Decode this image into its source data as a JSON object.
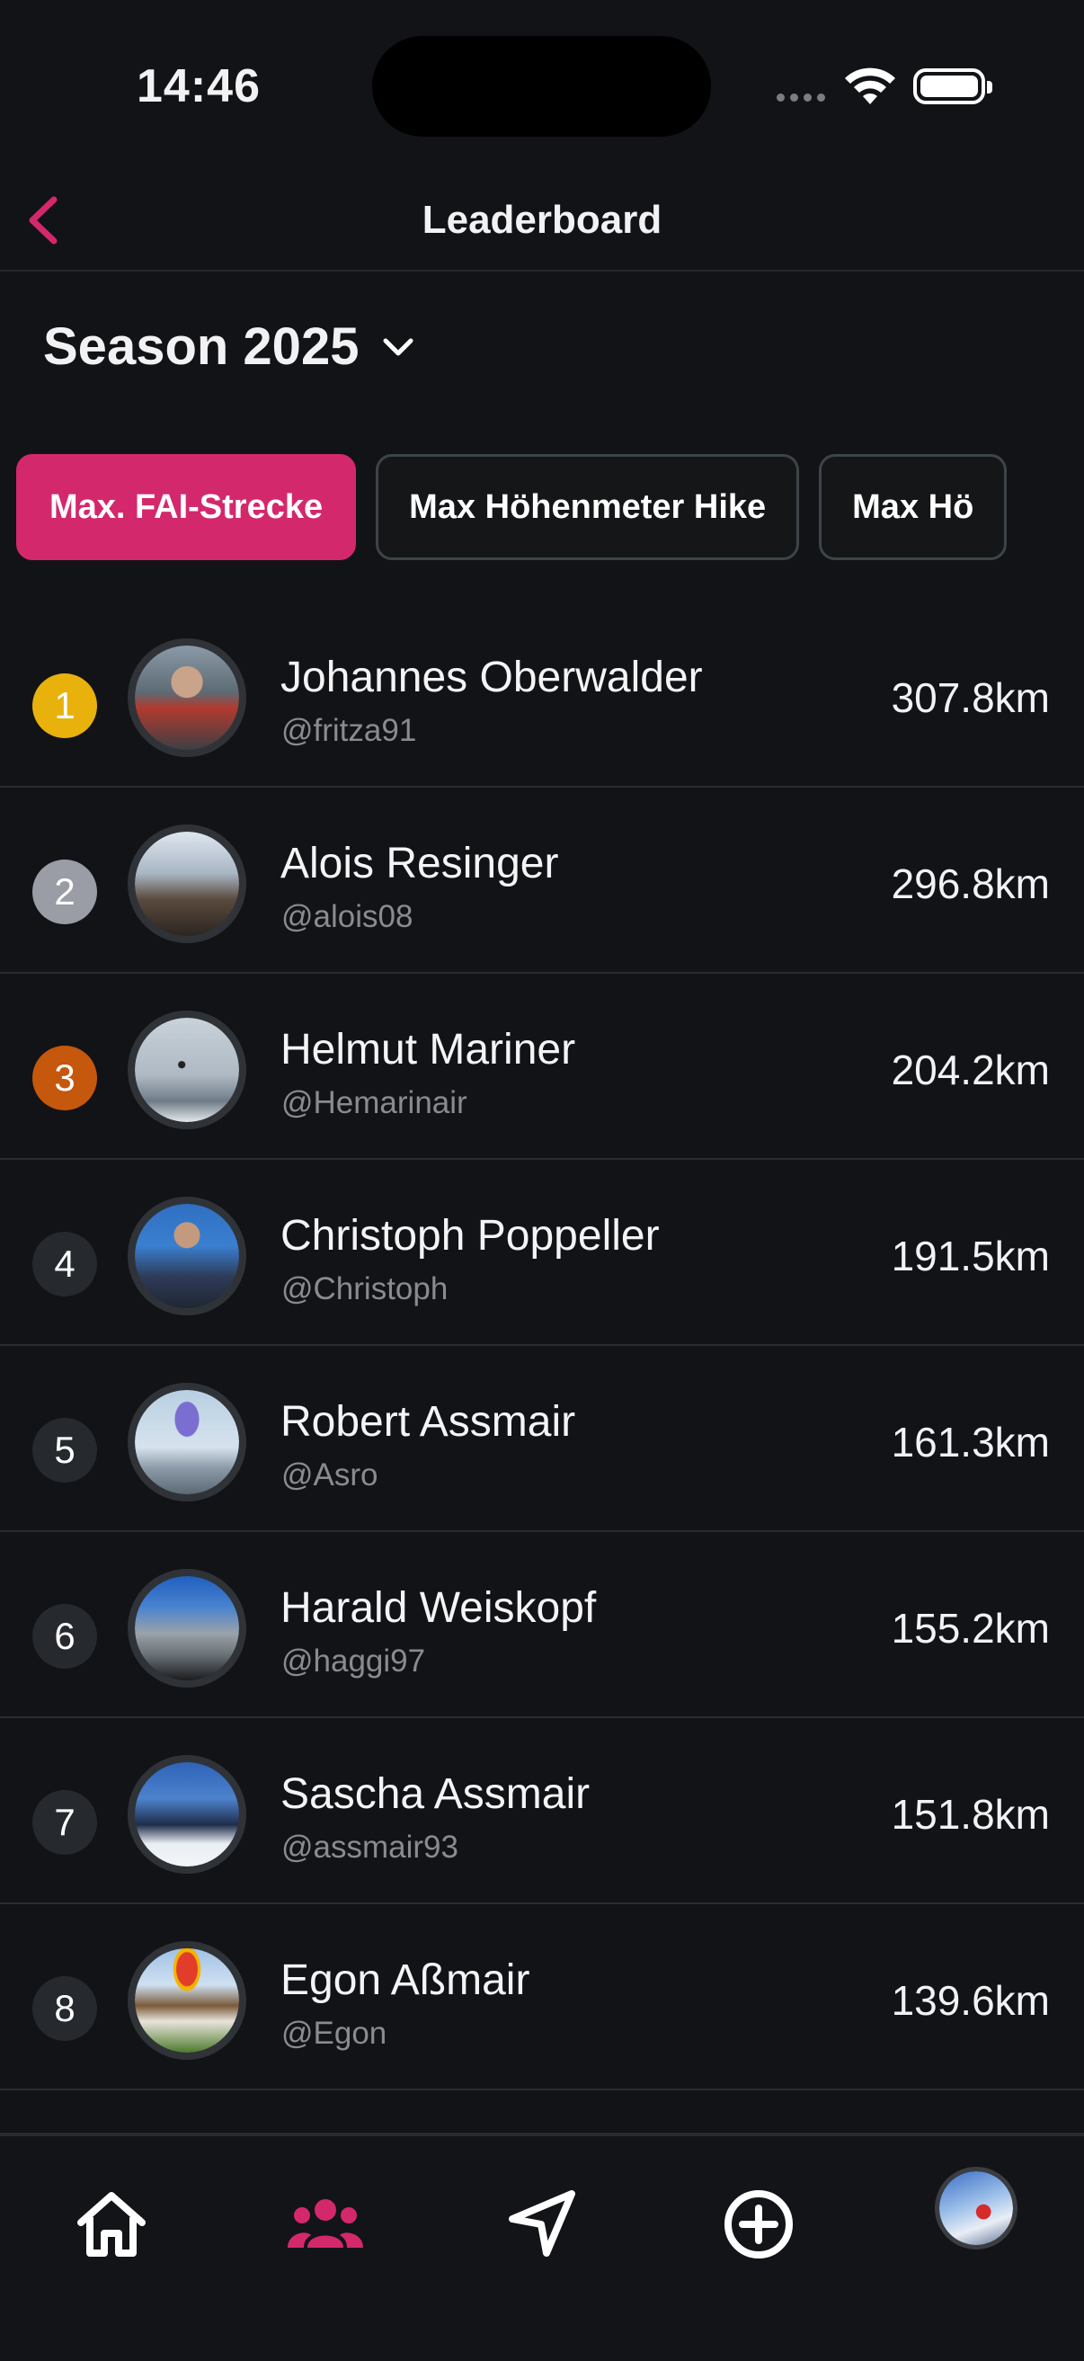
{
  "status": {
    "time": "14:46"
  },
  "header": {
    "title": "Leaderboard"
  },
  "season": {
    "label": "Season 2025"
  },
  "chips": [
    {
      "label": "Max. FAI-Strecke",
      "active": true
    },
    {
      "label": "Max Höhenmeter Hike",
      "active": false
    },
    {
      "label": "Max Hö",
      "active": false
    }
  ],
  "entries": [
    {
      "rank": "1",
      "name": "Johannes Oberwalder",
      "handle": "@fritza91",
      "value": "307.8km",
      "rank_color": "#e8b10c"
    },
    {
      "rank": "2",
      "name": "Alois Resinger",
      "handle": "@alois08",
      "value": "296.8km",
      "rank_color": "#9a9ca6"
    },
    {
      "rank": "3",
      "name": "Helmut Mariner",
      "handle": "@Hemarinair",
      "value": "204.2km",
      "rank_color": "#c5580c"
    },
    {
      "rank": "4",
      "name": "Christoph Poppeller",
      "handle": "@Christoph",
      "value": "191.5km",
      "rank_color": "#26292d"
    },
    {
      "rank": "5",
      "name": "Robert Assmair",
      "handle": "@Asro",
      "value": "161.3km",
      "rank_color": "#26292d"
    },
    {
      "rank": "6",
      "name": "Harald Weiskopf",
      "handle": "@haggi97",
      "value": "155.2km",
      "rank_color": "#26292d"
    },
    {
      "rank": "7",
      "name": "Sascha Assmair",
      "handle": "@assmair93",
      "value": "151.8km",
      "rank_color": "#26292d"
    },
    {
      "rank": "8",
      "name": "Egon Aßmair",
      "handle": "@Egon",
      "value": "139.6km",
      "rank_color": "#26292d"
    }
  ],
  "colors": {
    "accent": "#d4286d",
    "background": "#121316"
  },
  "tabbar": {
    "items": [
      {
        "icon": "home-icon",
        "active": false
      },
      {
        "icon": "community-icon",
        "active": true
      },
      {
        "icon": "navigation-icon",
        "active": false
      },
      {
        "icon": "add-icon",
        "active": false
      },
      {
        "icon": "profile-avatar",
        "active": false
      }
    ]
  }
}
